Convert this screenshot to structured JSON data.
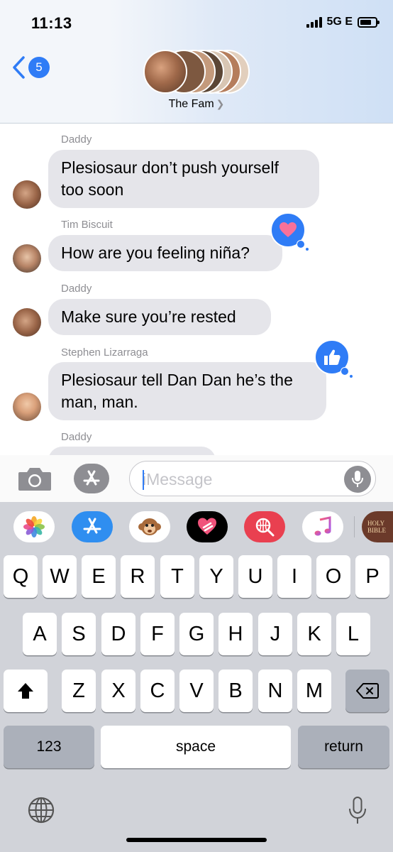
{
  "status_bar": {
    "time": "11:13",
    "network": "5G E"
  },
  "header": {
    "back_count": "5",
    "group_name": "The Fam",
    "avatar_colors": [
      "#a0694a",
      "#7d5840",
      "#c49a7c",
      "#5b4636",
      "#d8c6b4",
      "#b57d5c",
      "#e2cfbd"
    ]
  },
  "messages": [
    {
      "sender": "Daddy",
      "text_lines": [
        "Plesiosaur don’t push yourself",
        "too soon"
      ]
    },
    {
      "sender": "Tim Biscuit",
      "text_lines": [
        "How are you feeling niña?"
      ],
      "tapback": "heart-icon"
    },
    {
      "sender": "Daddy",
      "text_lines": [
        "Make sure you’re rested"
      ]
    },
    {
      "sender": "Stephen Lizarraga",
      "text_lines": [
        "Plesiosaur tell Dan Dan he’s the",
        "man, man."
      ],
      "tapback": "thumbs-up-icon"
    },
    {
      "sender": "Daddy"
    }
  ],
  "composer": {
    "placeholder": "iMessage"
  },
  "app_strip": [
    {
      "name": "photos-app",
      "bg": "#ffffff"
    },
    {
      "name": "app-store-app",
      "bg": "#2f8ef0"
    },
    {
      "name": "animoji-app",
      "bg": "#ffffff"
    },
    {
      "name": "digital-touch-app",
      "bg": "#000000"
    },
    {
      "name": "web-search-app",
      "bg": "#e94050"
    },
    {
      "name": "music-app",
      "bg": "#ffffff"
    },
    {
      "name": "holy-bible-app",
      "bg": "#6b3a2a",
      "label": "HOLY BIBLE"
    }
  ],
  "keyboard": {
    "row1": [
      "Q",
      "W",
      "E",
      "R",
      "T",
      "Y",
      "U",
      "I",
      "O",
      "P"
    ],
    "row2": [
      "A",
      "S",
      "D",
      "F",
      "G",
      "H",
      "J",
      "K",
      "L"
    ],
    "row3": [
      "Z",
      "X",
      "C",
      "V",
      "B",
      "N",
      "M"
    ],
    "numbers_label": "123",
    "space_label": "space",
    "return_label": "return"
  }
}
